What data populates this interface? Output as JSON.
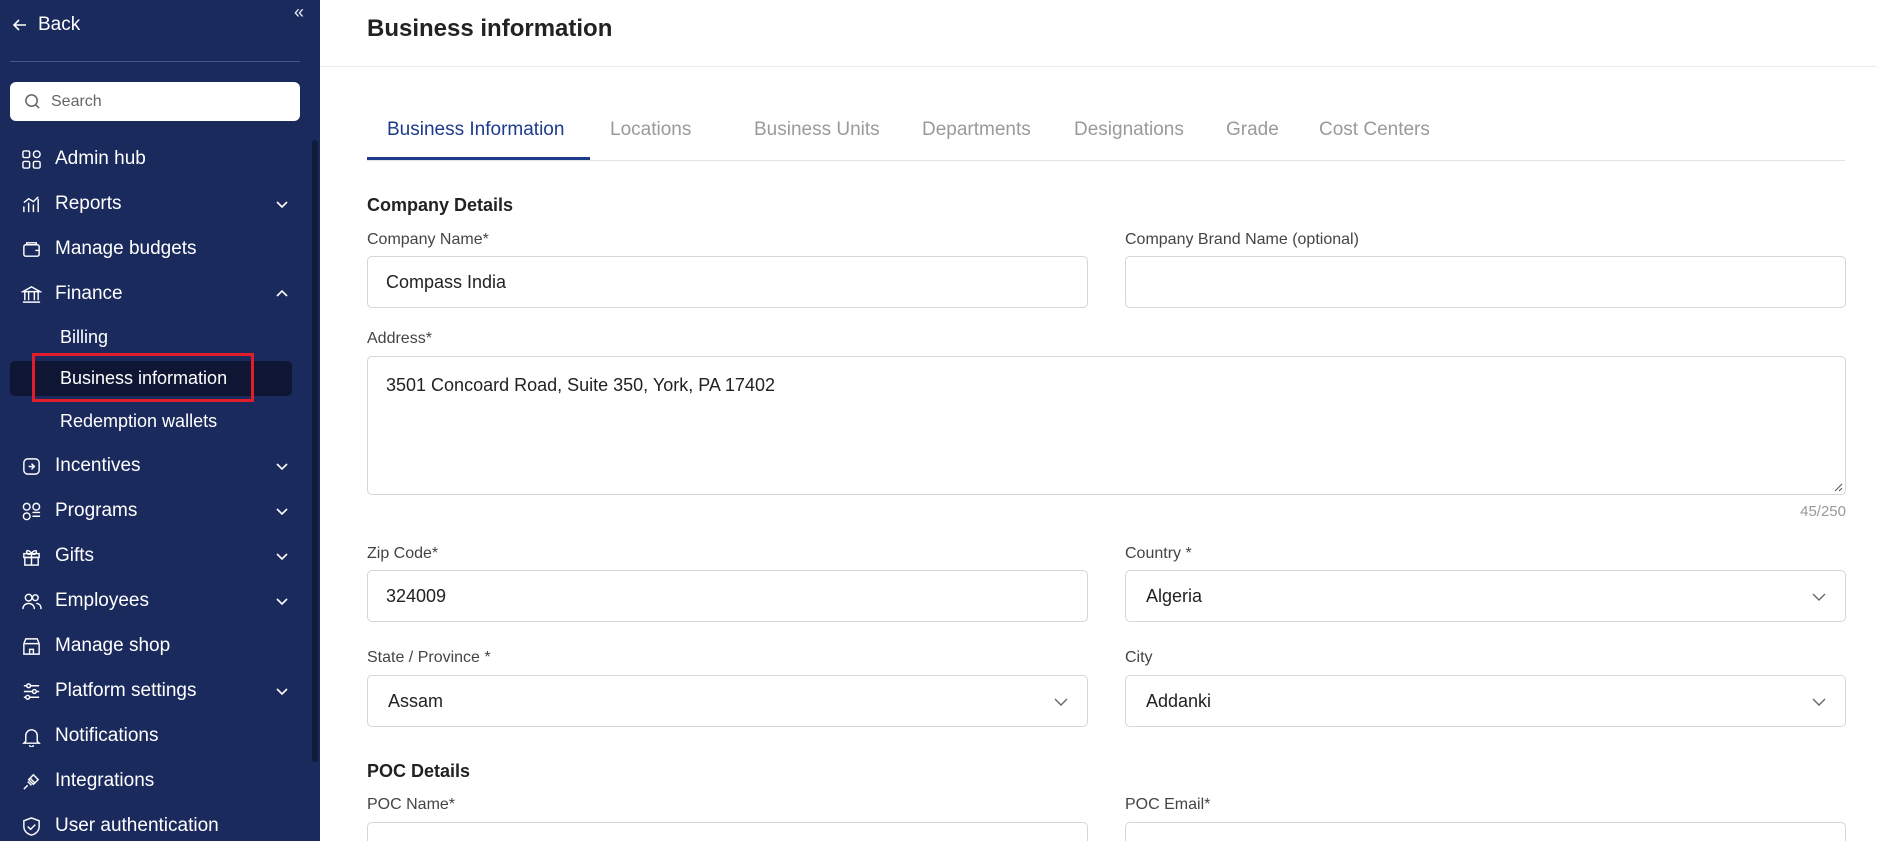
{
  "sidebar": {
    "back_label": "Back",
    "search_placeholder": "Search",
    "items": [
      {
        "label": "Admin hub",
        "icon": "grid-icon"
      },
      {
        "label": "Reports",
        "icon": "bar-chart-icon"
      },
      {
        "label": "Manage budgets",
        "icon": "budget-icon"
      },
      {
        "label": "Finance",
        "icon": "bank-icon"
      },
      {
        "label": "Incentives",
        "icon": "incentive-icon"
      },
      {
        "label": "Programs",
        "icon": "programs-icon"
      },
      {
        "label": "Gifts",
        "icon": "gift-icon"
      },
      {
        "label": "Employees",
        "icon": "users-icon"
      },
      {
        "label": "Manage shop",
        "icon": "shop-icon"
      },
      {
        "label": "Platform settings",
        "icon": "sliders-icon"
      },
      {
        "label": "Notifications",
        "icon": "bell-icon"
      },
      {
        "label": "Integrations",
        "icon": "plug-icon"
      },
      {
        "label": "User authentication",
        "icon": "shield-icon"
      }
    ],
    "finance_sub": [
      {
        "label": "Billing"
      },
      {
        "label": "Business information"
      },
      {
        "label": "Redemption wallets"
      }
    ]
  },
  "page": {
    "title": "Business information"
  },
  "tabs": [
    {
      "label": "Business Information"
    },
    {
      "label": "Locations"
    },
    {
      "label": "Business Units"
    },
    {
      "label": "Departments"
    },
    {
      "label": "Designations"
    },
    {
      "label": "Grade"
    },
    {
      "label": "Cost Centers"
    }
  ],
  "form": {
    "company_details_title": "Company Details",
    "company_name_label": "Company Name*",
    "company_name_value": "Compass India",
    "brand_name_label": "Company Brand Name (optional)",
    "brand_name_value": "",
    "address_label": "Address*",
    "address_value": "3501 Concoard Road, Suite 350, York, PA 17402",
    "address_counter": "45/250",
    "zip_label": "Zip Code*",
    "zip_value": "324009",
    "country_label": "Country *",
    "country_value": "Algeria",
    "state_label": "State / Province *",
    "state_value": "Assam",
    "city_label": "City",
    "city_value": "Addanki",
    "poc_details_title": "POC Details",
    "poc_name_label": "POC Name*",
    "poc_email_label": "POC Email*"
  },
  "colors": {
    "sidebar_bg": "#1b2a5c",
    "accent": "#1e3a8a",
    "highlight": "#e11d2a"
  }
}
